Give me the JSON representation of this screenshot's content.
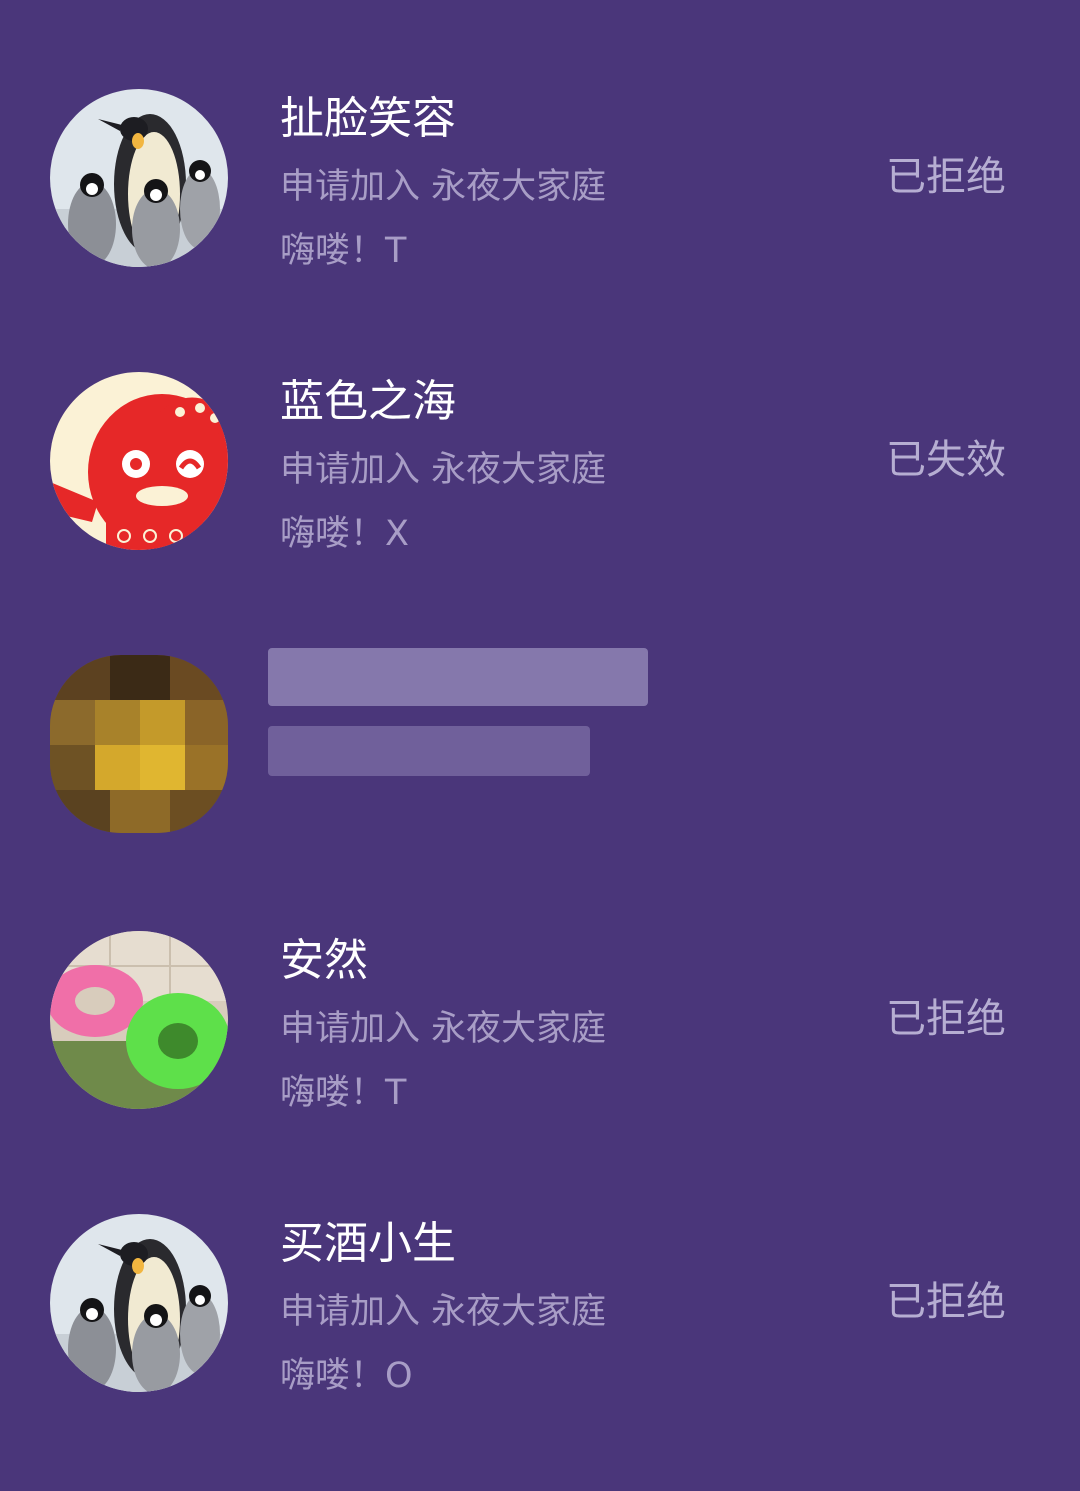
{
  "requests": [
    {
      "name": "扯脸笑容",
      "request_text": "申请加入 永夜大家庭",
      "message": "嗨喽！T",
      "status": "已拒绝",
      "avatar_icon": "penguin-avatar-icon"
    },
    {
      "name": "蓝色之海",
      "request_text": "申请加入 永夜大家庭",
      "message": "嗨喽！X",
      "status": "已失效",
      "avatar_icon": "red-mascot-avatar-icon"
    },
    {
      "name": "",
      "request_text": "",
      "message": "",
      "status": "",
      "avatar_icon": "pixelated-avatar-icon"
    },
    {
      "name": "安然",
      "request_text": "申请加入 永夜大家庭",
      "message": "嗨喽！T",
      "status": "已拒绝",
      "avatar_icon": "swim-rings-avatar-icon"
    },
    {
      "name": "买酒小生",
      "request_text": "申请加入 永夜大家庭",
      "message": "嗨喽！O",
      "status": "已拒绝",
      "avatar_icon": "penguin-avatar-icon"
    }
  ],
  "colors": {
    "background": "#4a367a",
    "name_text": "#ffffff",
    "secondary_text": "#a89dc6",
    "status_text": "#b6aed2"
  }
}
